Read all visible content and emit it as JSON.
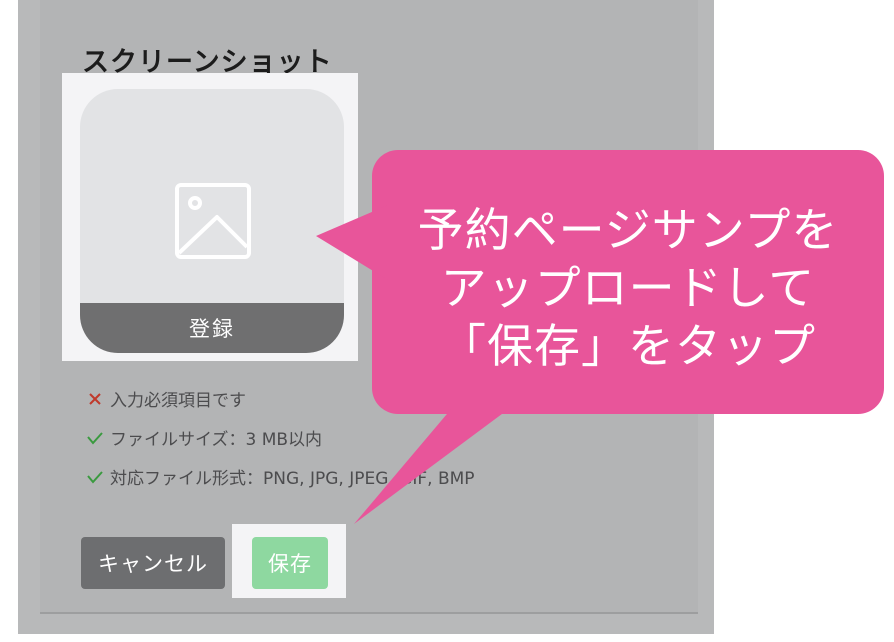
{
  "section": {
    "title": "スクリーンショット"
  },
  "upload": {
    "register_label": "登録",
    "placeholder_icon": "image-placeholder-icon"
  },
  "requirements": [
    {
      "icon": "x-mark-icon",
      "color": "#c0392b",
      "text": "入力必須項目です"
    },
    {
      "icon": "check-icon",
      "color": "#3a9a3f",
      "text": "ファイルサイズ：3 MB以内"
    },
    {
      "icon": "check-icon",
      "color": "#3a9a3f",
      "text": "対応ファイル形式：PNG, JPG, JPEG, GIF, BMP"
    }
  ],
  "buttons": {
    "cancel_label": "キャンセル",
    "save_label": "保存"
  },
  "callout": {
    "line1": "予約ページサンプを",
    "line2": "アップロードして",
    "line3": "「保存」をタップ",
    "color": "#e8559a"
  }
}
